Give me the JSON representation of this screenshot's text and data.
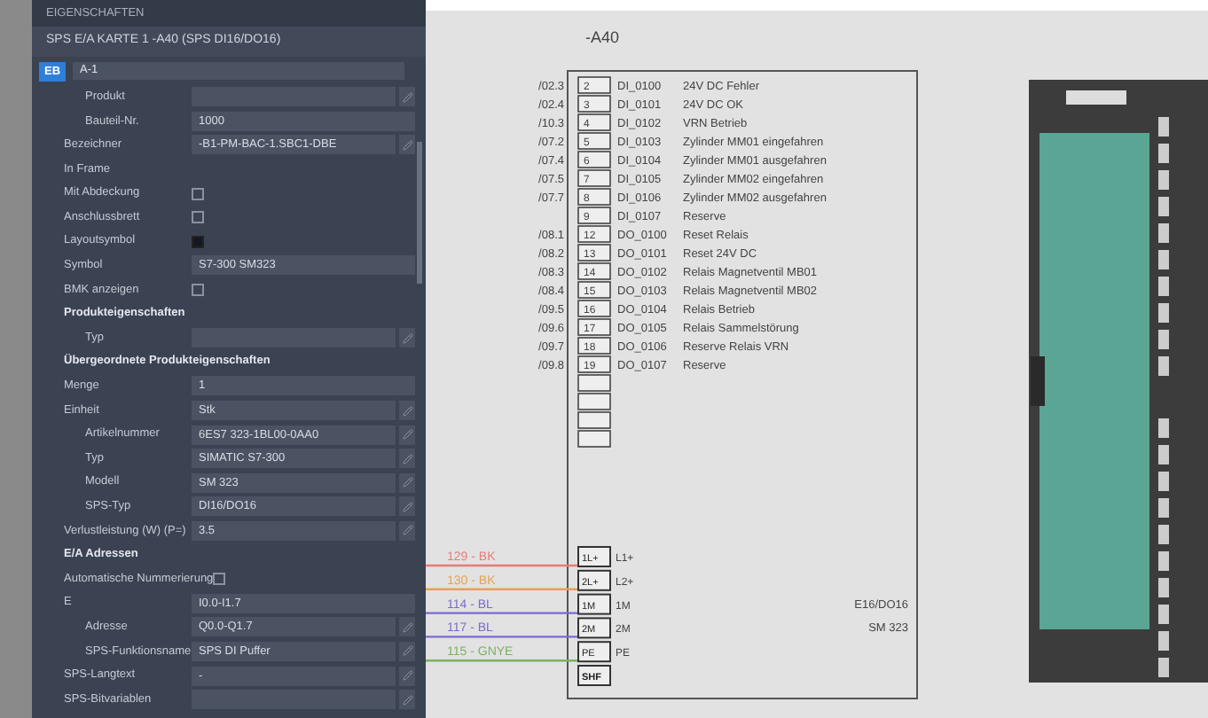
{
  "panel": {
    "title": "EIGENSCHAFTEN",
    "subtitle": "SPS E/A KARTE 1 -A40 (SPS DI16/DO16)",
    "badge": "EB",
    "identifier": {
      "value": "A-1",
      "children": [
        {
          "kind": "picker",
          "label": "Produkt"
        },
        {
          "kind": "field",
          "label": "Bauteil-Nr.",
          "value": "1000"
        }
      ]
    },
    "rows": [
      {
        "kind": "picker",
        "label": "Bezeichner",
        "value": "-B1-PM-BAC-1.SBC1-DBE"
      },
      {
        "kind": "label",
        "label": "In Frame"
      },
      {
        "kind": "check",
        "label": "Mit Abdeckung",
        "checked": false
      },
      {
        "kind": "check",
        "label": "Anschlussbrett",
        "checked": false
      },
      {
        "kind": "check",
        "label": "Layoutsymbol",
        "checked": true
      },
      {
        "kind": "field",
        "label": "Symbol",
        "value": "S7-300 SM323"
      },
      {
        "kind": "check",
        "label": "BMK anzeigen",
        "checked": false
      },
      {
        "kind": "section",
        "label": "Produkteigenschaften",
        "children": [
          {
            "kind": "picker",
            "label": "Typ"
          }
        ]
      },
      {
        "kind": "section",
        "label": "Übergeordnete Produkteigenschaften"
      },
      {
        "kind": "field",
        "label": "Menge",
        "value": "1"
      },
      {
        "kind": "picker",
        "label": "Einheit",
        "value": "Stk",
        "children": [
          {
            "kind": "picker",
            "label": "Artikelnummer",
            "value": "6ES7 323-1BL00-0AA0"
          },
          {
            "kind": "picker",
            "label": "Typ",
            "value": "SIMATIC S7-300"
          },
          {
            "kind": "picker",
            "label": "Modell",
            "value": "SM 323"
          },
          {
            "kind": "picker",
            "label": "SPS-Typ",
            "value": "DI16/DO16"
          }
        ]
      },
      {
        "kind": "picker",
        "label": "Verlustleistung (W) (P=)",
        "value": "3.5"
      },
      {
        "kind": "section",
        "label": "E/A Adressen"
      },
      {
        "kind": "check",
        "label": "Automatische Nummerierung",
        "checked": false
      },
      {
        "kind": "field",
        "label": "E",
        "value": "I0.0-I1.7",
        "children": [
          {
            "kind": "picker",
            "label": "Adresse",
            "value": "Q0.0-Q1.7"
          },
          {
            "kind": "picker",
            "label": "SPS-Funktionsname",
            "value": "SPS DI Puffer"
          }
        ]
      },
      {
        "kind": "picker",
        "label": "SPS-Langtext",
        "value": "-"
      },
      {
        "kind": "picker",
        "label": "SPS-Bitvariablen"
      }
    ]
  },
  "schematic": {
    "title": "-A40",
    "pins": [
      {
        "kind": "signal",
        "ref": "/02.3",
        "pin": "2",
        "tag": "DI_0100",
        "text": "24V DC Fehler"
      },
      {
        "kind": "signal",
        "ref": "/02.4",
        "pin": "3",
        "tag": "DI_0101",
        "text": "24V DC  OK"
      },
      {
        "kind": "signal",
        "ref": "/10.3",
        "pin": "4",
        "tag": "DI_0102",
        "text": "VRN Betrieb"
      },
      {
        "kind": "signal",
        "ref": "/07.2",
        "pin": "5",
        "tag": "DI_0103",
        "text": "Zylinder MM01 eingefahren"
      },
      {
        "kind": "signal",
        "ref": "/07.4",
        "pin": "6",
        "tag": "DI_0104",
        "text": "Zylinder MM01 ausgefahren"
      },
      {
        "kind": "signal",
        "ref": "/07.5",
        "pin": "7",
        "tag": "DI_0105",
        "text": "Zylinder MM02 eingefahren"
      },
      {
        "kind": "signal",
        "ref": "/07.7",
        "pin": "8",
        "tag": "DI_0106",
        "text": "Zylinder MM02 ausgefahren"
      },
      {
        "kind": "signal",
        "pin": "9",
        "tag": "DI_0107",
        "text": "Reserve"
      },
      {
        "kind": "signal",
        "ref": "/08.1",
        "pin": "12",
        "tag": "DO_0100",
        "text": "Reset Relais"
      },
      {
        "kind": "signal",
        "ref": "/08.2",
        "pin": "13",
        "tag": "DO_0101",
        "text": "Reset 24V DC"
      },
      {
        "kind": "signal",
        "ref": "/08.3",
        "pin": "14",
        "tag": "DO_0102",
        "text": "Relais Magnetventil MB01"
      },
      {
        "kind": "signal",
        "ref": "/08.4",
        "pin": "15",
        "tag": "DO_0103",
        "text": "Relais Magnetventil MB02"
      },
      {
        "kind": "signal",
        "ref": "/09.5",
        "pin": "16",
        "tag": "DO_0104",
        "text": "Relais Betrieb"
      },
      {
        "kind": "signal",
        "ref": "/09.6",
        "pin": "17",
        "tag": "DO_0105",
        "text": "Relais Sammelstörung"
      },
      {
        "kind": "signal",
        "ref": "/09.7",
        "pin": "18",
        "tag": "DO_0106",
        "text": "Reserve Relais VRN"
      },
      {
        "kind": "signal",
        "ref": "/09.8",
        "pin": "19",
        "tag": "DO_0107",
        "text": "Reserve"
      },
      {
        "kind": "spare"
      },
      {
        "kind": "spare"
      },
      {
        "kind": "spare"
      },
      {
        "kind": "spare"
      }
    ],
    "power": [
      {
        "pin": "1L+",
        "tag": "L1+",
        "wire": "129 - BK",
        "color": "#e87a7a"
      },
      {
        "pin": "2L+",
        "tag": "L2+",
        "wire": "130 - BK",
        "color": "#e8a050"
      },
      {
        "pin": "1M",
        "tag": "1M",
        "wire": "114 - BL",
        "color": "#7a6ad0"
      },
      {
        "pin": "2M",
        "tag": "2M",
        "wire": "117 - BL",
        "color": "#7a6ad0"
      },
      {
        "pin": "PE",
        "tag": "PE",
        "wire": "115 - GNYE",
        "color": "#7cb060"
      },
      {
        "pin": "SHF"
      }
    ],
    "module_type": "E16/DO16",
    "module_model": "SM 323"
  }
}
